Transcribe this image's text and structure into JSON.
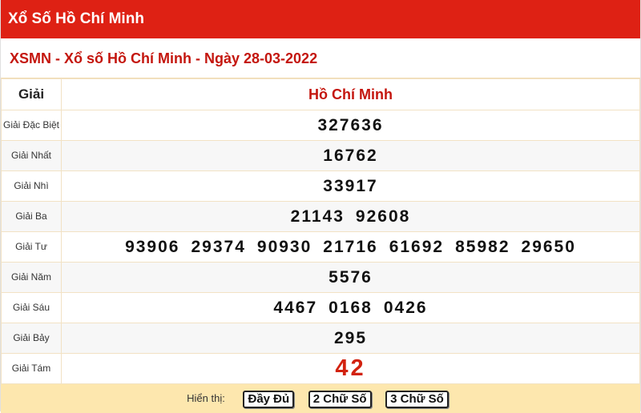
{
  "header": {
    "title": "Xổ Số Hồ Chí Minh"
  },
  "subtitle": "XSMN - Xổ số Hồ Chí Minh - Ngày 28-03-2022",
  "table": {
    "col_label": "Giải",
    "col_province": "Hồ Chí Minh",
    "rows": [
      {
        "label": "Giải Đặc Biệt",
        "numbers": [
          "327636"
        ]
      },
      {
        "label": "Giải Nhất",
        "numbers": [
          "16762"
        ]
      },
      {
        "label": "Giải Nhì",
        "numbers": [
          "33917"
        ]
      },
      {
        "label": "Giải Ba",
        "numbers": [
          "21143",
          "92608"
        ]
      },
      {
        "label": "Giải Tư",
        "numbers": [
          "93906",
          "29374",
          "90930",
          "21716",
          "61692",
          "85982",
          "29650"
        ]
      },
      {
        "label": "Giải Năm",
        "numbers": [
          "5576"
        ]
      },
      {
        "label": "Giải Sáu",
        "numbers": [
          "4467",
          "0168",
          "0426"
        ]
      },
      {
        "label": "Giải Bảy",
        "numbers": [
          "295"
        ]
      },
      {
        "label": "Giải Tám",
        "numbers": [
          "42"
        ]
      }
    ]
  },
  "footer": {
    "label": "Hiển thị:",
    "buttons": [
      "Đầy Đủ",
      "2 Chữ Số",
      "3 Chữ Số"
    ]
  },
  "colors": {
    "header_bg": "#de2114",
    "accent_red": "#c4160e",
    "footer_bg": "#fde7ae"
  }
}
